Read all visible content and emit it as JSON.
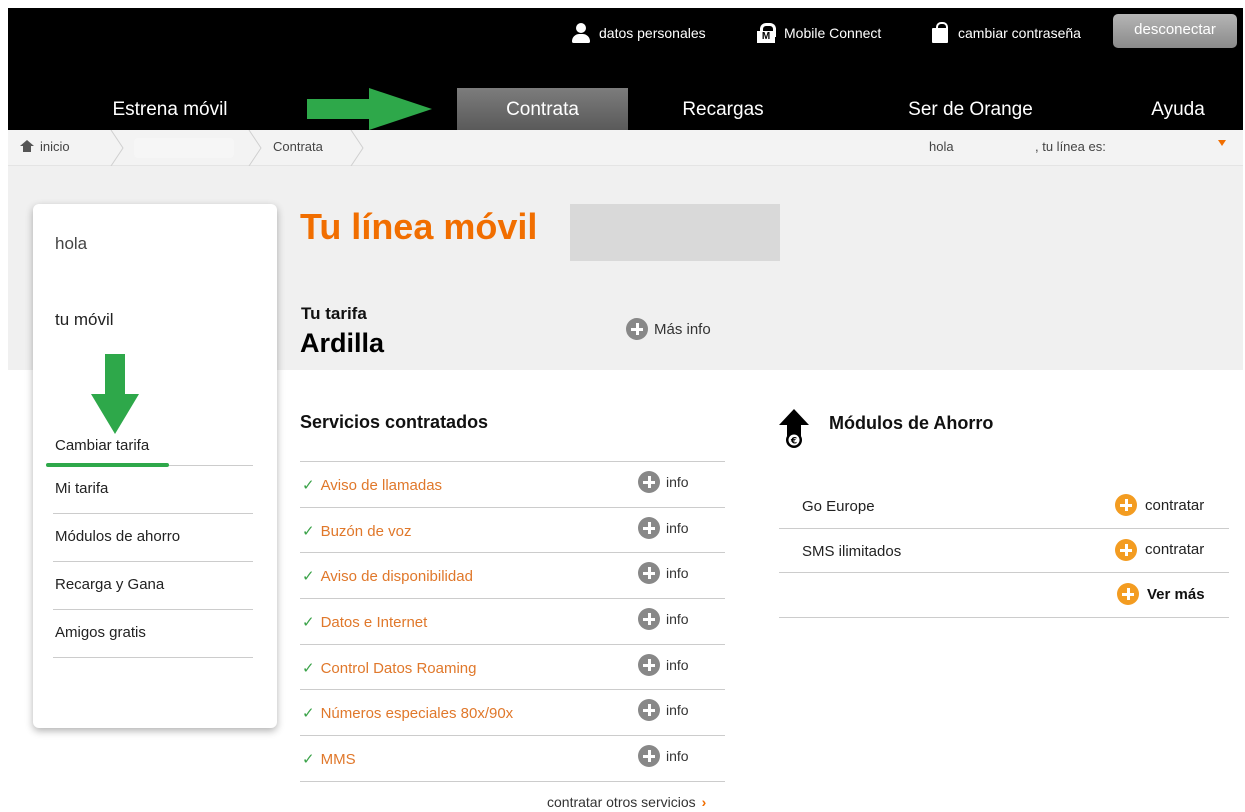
{
  "topbar": {
    "personal_data": "datos personales",
    "mobile_connect": "Mobile Connect",
    "change_password": "cambiar contraseña",
    "disconnect": "desconectar"
  },
  "nav": {
    "items": [
      "Estrena móvil",
      "Contrata",
      "Recargas",
      "Ser de Orange",
      "Ayuda"
    ],
    "active": "Contrata"
  },
  "breadcrumb": {
    "home": "inicio",
    "current": "Contrata",
    "greeting": "hola",
    "line_label": ", tu línea es:"
  },
  "sidebar": {
    "hello": "hola",
    "mobile": "tu móvil",
    "links": [
      "Cambiar tarifa",
      "Mi tarifa",
      "Módulos de ahorro",
      "Recarga y Gana",
      "Amigos gratis"
    ]
  },
  "main": {
    "title": "Tu línea móvil",
    "tariff_label": "Tu tarifa",
    "tariff_name": "Ardilla",
    "more_info": "Más info"
  },
  "services": {
    "title": "Servicios contratados",
    "info_label": "info",
    "items": [
      "Aviso de llamadas",
      "Buzón de voz",
      "Aviso de disponibilidad",
      "Datos e Internet",
      "Control Datos Roaming",
      "Números especiales 80x/90x",
      "MMS"
    ],
    "more_services": "contratar otros servicios"
  },
  "savings": {
    "title": "Módulos de Ahorro",
    "items": [
      {
        "name": "Go Europe",
        "action": "contratar"
      },
      {
        "name": "SMS ilimitados",
        "action": "contratar"
      }
    ],
    "see_more": "Ver más"
  },
  "colors": {
    "brand_orange": "#f16e00",
    "service_text": "#e0782b",
    "annotation_green": "#2ea84a"
  }
}
